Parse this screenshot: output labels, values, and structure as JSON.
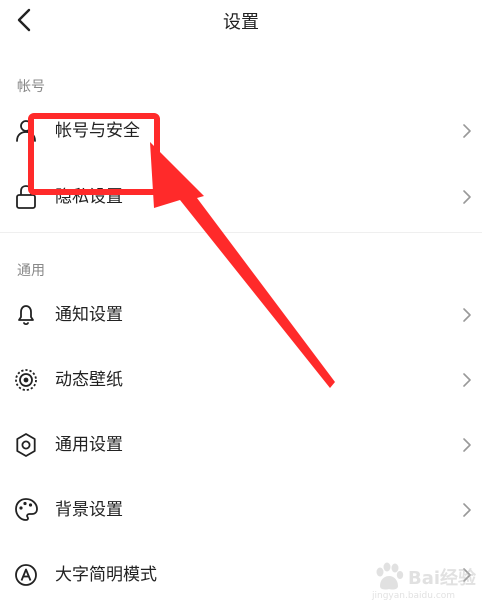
{
  "header": {
    "title": "设置",
    "back_icon": "back-arrow-icon"
  },
  "sections": [
    {
      "title": "帐号"
    },
    {
      "title": "通用"
    }
  ],
  "items": [
    {
      "label": "帐号与安全",
      "icon": "user-icon"
    },
    {
      "label": "隐私设置",
      "icon": "lock-icon"
    },
    {
      "label": "通知设置",
      "icon": "bell-icon"
    },
    {
      "label": "动态壁纸",
      "icon": "wallpaper-icon"
    },
    {
      "label": "通用设置",
      "icon": "gear-icon"
    },
    {
      "label": "背景设置",
      "icon": "palette-icon"
    },
    {
      "label": "大字简明模式",
      "icon": "font-size-icon"
    }
  ],
  "annotation": {
    "color": "#ff2a2a"
  },
  "watermark": {
    "text": "Bai经验",
    "sub": "jingyan.baidu.com"
  }
}
